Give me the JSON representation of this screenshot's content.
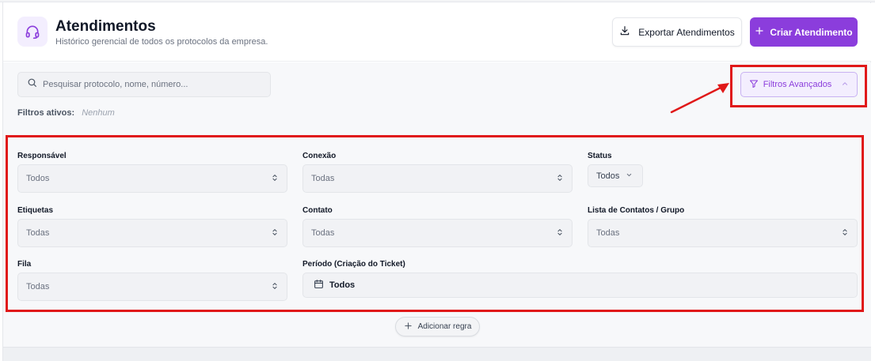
{
  "header": {
    "title": "Atendimentos",
    "subtitle": "Histórico gerencial de todos os protocolos da empresa.",
    "icon": "headset-icon",
    "export_label": "Exportar Atendimentos",
    "create_label": "Criar Atendimento"
  },
  "search": {
    "placeholder": "Pesquisar protocolo, nome, número...",
    "value": ""
  },
  "active_filters": {
    "label": "Filtros ativos:",
    "value": "Nenhum"
  },
  "advanced_filters": {
    "label": "Filtros Avançados",
    "expanded": true
  },
  "filters": {
    "responsavel": {
      "label": "Responsável",
      "value": "Todos"
    },
    "conexao": {
      "label": "Conexão",
      "value": "Todas"
    },
    "status": {
      "label": "Status",
      "value": "Todos"
    },
    "etiquetas": {
      "label": "Etiquetas",
      "value": "Todas"
    },
    "contato": {
      "label": "Contato",
      "value": "Todas"
    },
    "lista": {
      "label": "Lista de Contatos / Grupo",
      "value": "Todas"
    },
    "fila": {
      "label": "Fila",
      "value": "Todas"
    },
    "periodo": {
      "label": "Período (Criação do Ticket)",
      "value": "Todos"
    }
  },
  "add_rule_label": "Adicionar regra",
  "colors": {
    "accent": "#8b3ddc",
    "accent_light": "#f3eefe",
    "annotation": "#e01919"
  }
}
